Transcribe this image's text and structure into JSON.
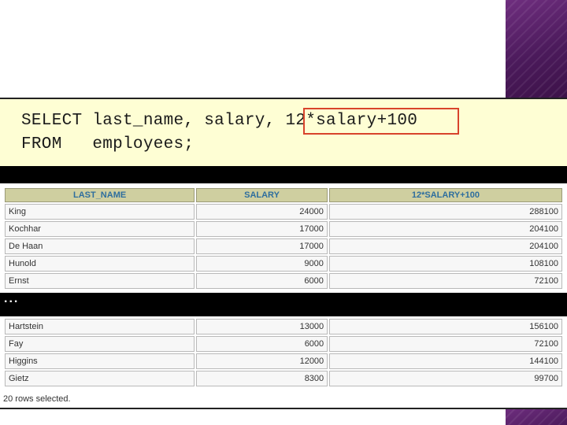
{
  "sql": {
    "line1_prefix": "SELECT last_name, salary, ",
    "line1_expression": "12*salary+100",
    "line2": "FROM   employees;"
  },
  "table": {
    "columns": [
      "LAST_NAME",
      "SALARY",
      "12*SALARY+100"
    ],
    "rows_top": [
      [
        "King",
        "24000",
        "288100"
      ],
      [
        "Kochhar",
        "17000",
        "204100"
      ],
      [
        "De Haan",
        "17000",
        "204100"
      ],
      [
        "Hunold",
        "9000",
        "108100"
      ],
      [
        "Ernst",
        "6000",
        "72100"
      ]
    ],
    "ellipsis": "...",
    "rows_bottom": [
      [
        "Hartstein",
        "13000",
        "156100"
      ],
      [
        "Fay",
        "6000",
        "72100"
      ],
      [
        "Higgins",
        "12000",
        "144100"
      ],
      [
        "Gietz",
        "8300",
        "99700"
      ]
    ],
    "footer": "20 rows selected."
  },
  "colors": {
    "accent_purple": "#5a2169",
    "sql_background": "#fefed4",
    "highlight_border": "#d8432b",
    "header_background": "#cfcfa0",
    "header_text": "#2e6e9e"
  }
}
